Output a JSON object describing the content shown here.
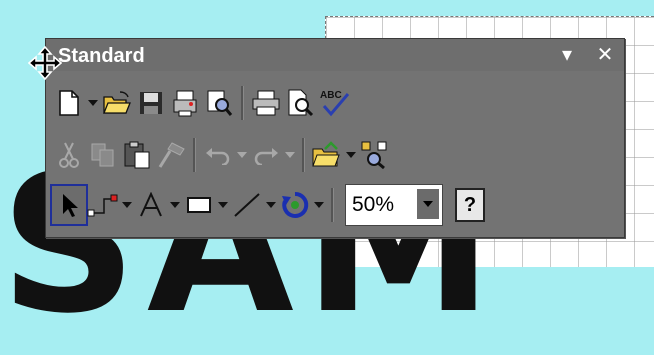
{
  "window": {
    "title": "Standard"
  },
  "title_buttons": {
    "menu_glyph": "▾",
    "close_glyph": "✕"
  },
  "standard_row": {
    "icons": [
      "new-icon",
      "open-icon",
      "save-icon",
      "permission-icon",
      "research-icon",
      "print-icon",
      "print-preview-icon",
      "spelling-icon"
    ]
  },
  "edit_row": {
    "icons": [
      "cut-icon",
      "copy-icon",
      "paste-icon",
      "format-painter-icon",
      "undo-icon",
      "redo-icon",
      "insert-hyperlink-icon",
      "research-icon"
    ]
  },
  "drawing_row": {
    "zoom_value": "50%",
    "help_label": "?"
  },
  "watermark": {
    "text": "SAM"
  },
  "colors": {
    "toolbar_bg": "#737373",
    "canvas_bg": "#a6eef2",
    "selection": "#1f2f9a"
  }
}
